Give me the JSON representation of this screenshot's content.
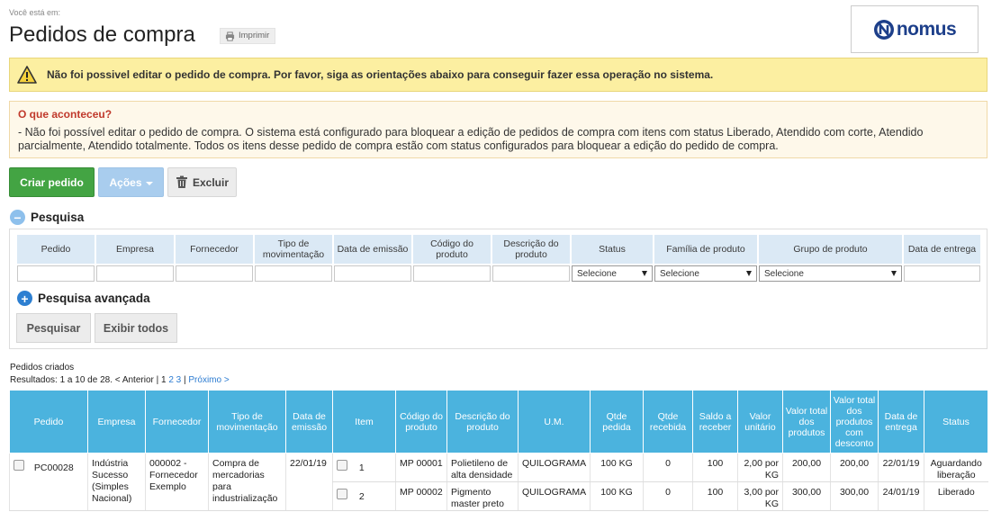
{
  "header": {
    "breadcrumb": "Você está em:",
    "title": "Pedidos de compra",
    "print_label": "Imprimir",
    "logo_text": "nomus"
  },
  "alert": {
    "message": "Não foi possivel editar o pedido de compra. Por favor, siga as orientações abaixo para conseguir fazer essa operação no sistema."
  },
  "info": {
    "heading": "O que aconteceu?",
    "body": "- Não foi possível editar o pedido de compra. O sistema está configurado para bloquear a edição de pedidos de compra com itens com status Liberado, Atendido com corte, Atendido parcialmente, Atendido totalmente. Todos os itens desse pedido de compra estão com status configurados para bloquear a edição do pedido de compra."
  },
  "toolbar": {
    "create_label": "Criar pedido",
    "actions_label": "Ações",
    "delete_label": "Excluir"
  },
  "search": {
    "heading": "Pesquisa",
    "advanced_label": "Pesquisa avançada",
    "search_button": "Pesquisar",
    "show_all_button": "Exibir todos",
    "columns": [
      "Pedido",
      "Empresa",
      "Fornecedor",
      "Tipo de movimentação",
      "Data de emissão",
      "Código do produto",
      "Descrição do produto",
      "Status",
      "Família de produto",
      "Grupo de produto",
      "Data de entrega"
    ],
    "select_placeholder": "Selecione"
  },
  "results": {
    "title": "Pedidos criados",
    "prefix": "Resultados: 1 a 10 de 28. < Anterior | 1 ",
    "page2": "2",
    "page3": "3",
    "sep": " | ",
    "next": "Próximo >"
  },
  "table": {
    "headers": [
      "Pedido",
      "Empresa",
      "Fornecedor",
      "Tipo de movimentação",
      "Data de emissão",
      "Item",
      "Código do produto",
      "Descrição do produto",
      "U.M.",
      "Qtde pedida",
      "Qtde recebida",
      "Saldo a receber",
      "Valor unitário",
      "Valor total dos produtos",
      "Valor total dos produtos com desconto",
      "Data de entrega",
      "Status"
    ],
    "order": {
      "pedido": "PC00028",
      "empresa": "Indústria Sucesso (Simples Nacional)",
      "fornecedor": "000002 - Fornecedor Exemplo",
      "tipo": "Compra de mercadorias para industrialização",
      "emissao": "22/01/19"
    },
    "items": [
      {
        "item": "1",
        "codigo": "MP 00001",
        "descricao": "Polietileno de alta densidade",
        "um": "QUILOGRAMA",
        "qtde": "100 KG",
        "recebida": "0",
        "saldo": "100",
        "unitario": "2,00 por KG",
        "total": "200,00",
        "desconto": "200,00",
        "entrega": "22/01/19",
        "status": "Aguardando liberação"
      },
      {
        "item": "2",
        "codigo": "MP 00002",
        "descricao": "Pigmento master preto",
        "um": "QUILOGRAMA",
        "qtde": "100 KG",
        "recebida": "0",
        "saldo": "100",
        "unitario": "3,00 por KG",
        "total": "300,00",
        "desconto": "300,00",
        "entrega": "24/01/19",
        "status": "Liberado"
      }
    ]
  },
  "colors": {
    "header_blue": "#4bb3de",
    "create_green": "#43a443",
    "warning_bg": "#fcefa1",
    "info_heading": "#c0392b"
  }
}
